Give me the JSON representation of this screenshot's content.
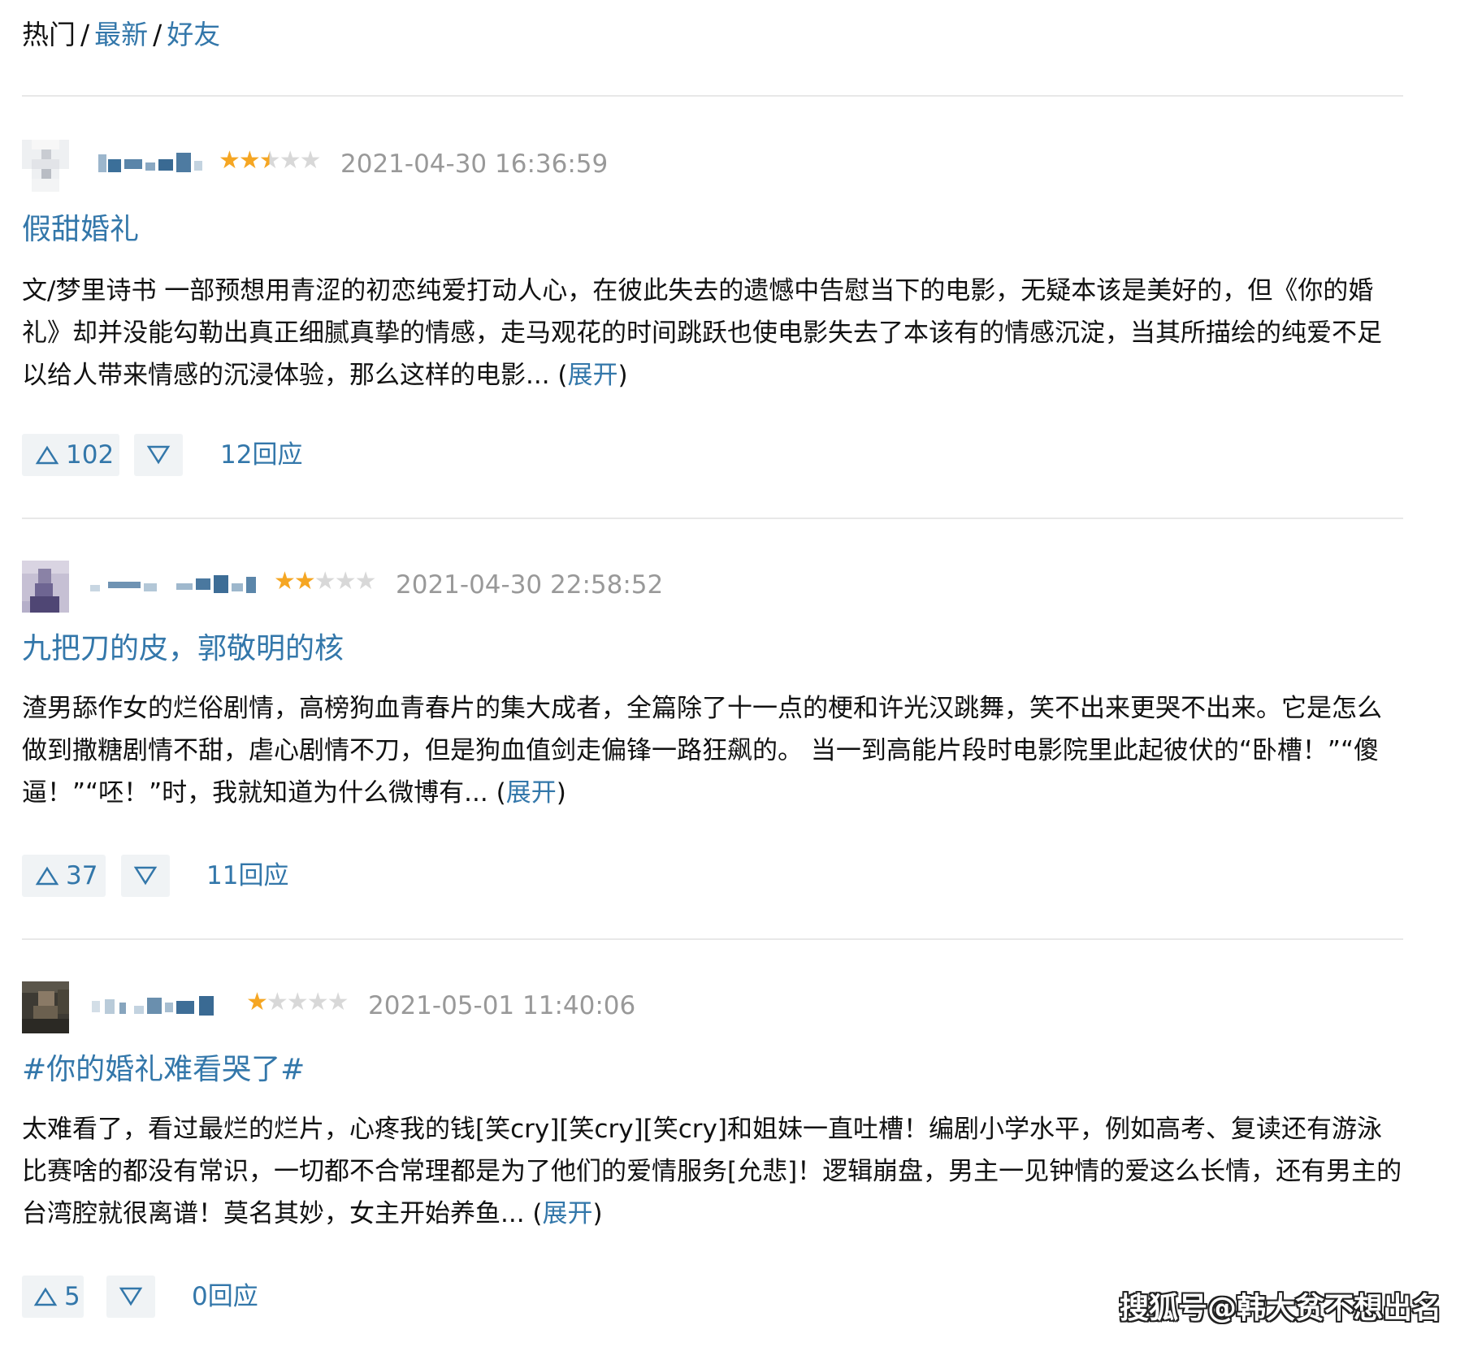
{
  "tabs": {
    "active": "热门",
    "separator": "/",
    "latest": "最新",
    "friends": "好友"
  },
  "colors": {
    "link": "#3377aa",
    "star_on": "#f5a623",
    "star_off": "#d8d8d8",
    "vote_bg": "#f0f3f5",
    "meta_gray": "#999999"
  },
  "reviews": [
    {
      "rating": 2.5,
      "rating_max": 5,
      "time": "2021-04-30 16:36:59",
      "title": "假甜婚礼",
      "text": "文/梦里诗书 一部预想用青涩的初恋纯爱打动人心，在彼此失去的遗憾中告慰当下的电影，无疑本该是美好的，但《你的婚礼》却并没能勾勒出真正细腻真挚的情感，走马观花的时间跳跃也使电影失去了本该有的情感沉淀，当其所描绘的纯爱不足以给人带来情感的沉浸体验，那么这样的电影...",
      "expand_open": "(",
      "expand_label": "展开",
      "expand_close": ")",
      "up_icon": "triangle-up-icon",
      "down_icon": "triangle-down-icon",
      "up_count": "102",
      "replies": "12回应"
    },
    {
      "rating": 2,
      "rating_max": 5,
      "time": "2021-04-30 22:58:52",
      "title": "九把刀的皮，郭敬明的核",
      "text": "渣男舔作女的烂俗剧情，高榜狗血青春片的集大成者，全篇除了十一点的梗和许光汉跳舞，笑不出来更哭不出来。它是怎么做到撒糖剧情不甜，虐心剧情不刀，但是狗血值剑走偏锋一路狂飙的。 当一到高能片段时电影院里此起彼伏的“卧槽！”“傻逼！”“呸！”时，我就知道为什么微博有...",
      "expand_open": "(",
      "expand_label": "展开",
      "expand_close": ")",
      "up_icon": "triangle-up-icon",
      "down_icon": "triangle-down-icon",
      "up_count": "37",
      "replies": "11回应"
    },
    {
      "rating": 1,
      "rating_max": 5,
      "time": "2021-05-01 11:40:06",
      "title": "#你的婚礼难看哭了#",
      "text": "太难看了，看过最烂的烂片，心疼我的钱[笑cry][笑cry][笑cry]和姐妹一直吐槽！编剧小学水平，例如高考、复读还有游泳比赛啥的都没有常识，一切都不合常理都是为了他们的爱情服务[允悲]！逻辑崩盘，男主一见钟情的爱这么长情，还有男主的台湾腔就很离谱！莫名其妙，女主开始养鱼...",
      "expand_open": "(",
      "expand_label": "展开",
      "expand_close": ")",
      "up_icon": "triangle-up-icon",
      "down_icon": "triangle-down-icon",
      "up_count": "5",
      "replies": "0回应"
    }
  ],
  "watermark": "搜狐号@韩大贫不想出名"
}
